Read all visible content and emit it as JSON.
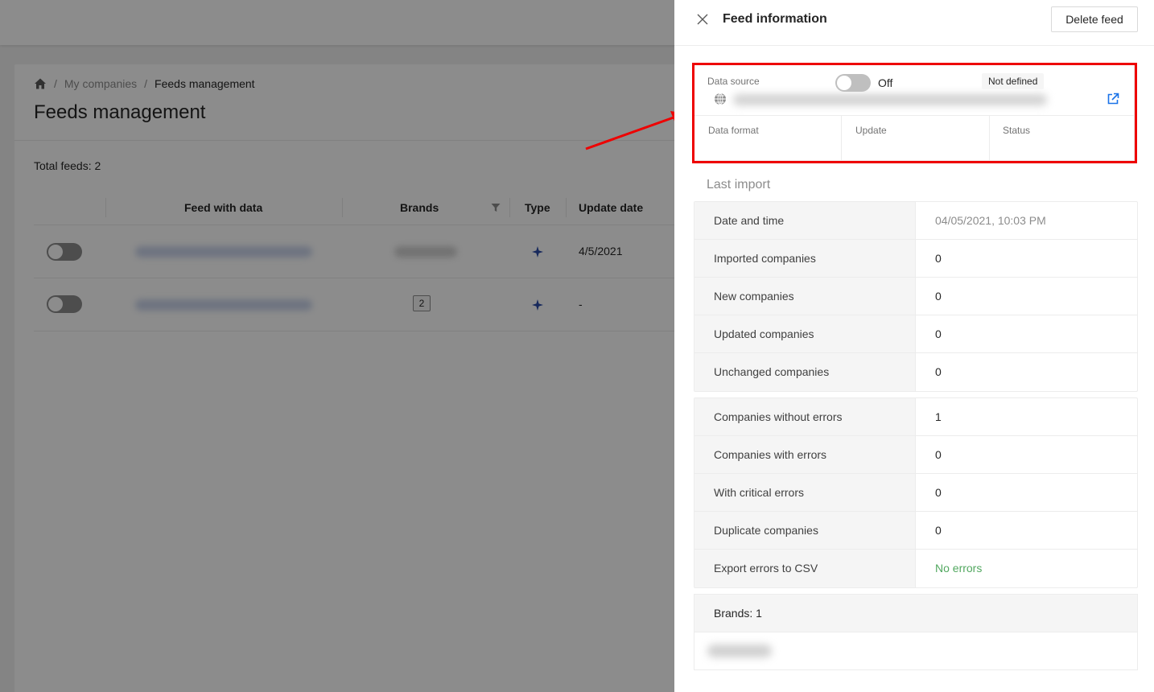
{
  "background": {
    "breadcrumb": [
      "My companies",
      "Feeds management"
    ],
    "page_title": "Feeds management",
    "total_feeds": "Total feeds: 2",
    "table": {
      "columns": [
        "Feed with data",
        "Brands",
        "Type",
        "Update date"
      ],
      "rows": [
        {
          "update_date": "4/5/2021",
          "brands": ""
        },
        {
          "update_date": "-",
          "brands": "2"
        }
      ]
    }
  },
  "drawer": {
    "title": "Feed information",
    "delete_label": "Delete feed",
    "data_source_label": "Data source",
    "data_format_label": "Data format",
    "update_label": "Update",
    "update_state": "Off",
    "status_label": "Status",
    "status_value": "Not defined",
    "last_import_title": "Last import",
    "import_rows": [
      {
        "key": "Date and time",
        "value": "04/05/2021, 10:03 PM"
      },
      {
        "key": "Imported companies",
        "value": "0"
      },
      {
        "key": "New companies",
        "value": "0"
      },
      {
        "key": "Updated companies",
        "value": "0"
      },
      {
        "key": "Unchanged companies",
        "value": "0"
      }
    ],
    "error_rows": [
      {
        "key": "Companies without errors",
        "value": "1"
      },
      {
        "key": "Companies with errors",
        "value": "0"
      },
      {
        "key": "With critical errors",
        "value": "0"
      },
      {
        "key": "Duplicate companies",
        "value": "0"
      },
      {
        "key": "Export errors to CSV",
        "value": "No errors"
      }
    ],
    "brands_title": "Brands: 1"
  },
  "colors": {
    "highlight": "#ee0000",
    "link_blue": "#1a73e8",
    "success_green": "#52a860",
    "type_icon": "#2a4ba8"
  },
  "icons": [
    "home-icon",
    "filter-icon",
    "sparkle-icon",
    "close-icon",
    "globe-icon",
    "external-link-icon"
  ]
}
